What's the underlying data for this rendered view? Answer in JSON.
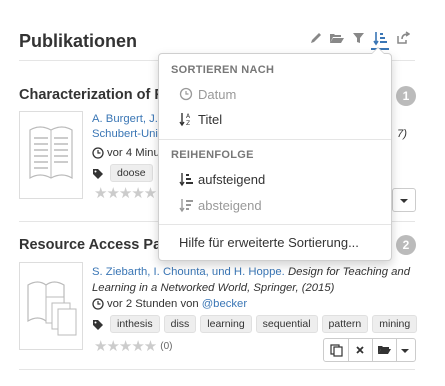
{
  "header": {
    "title": "Publikationen"
  },
  "toolbar": {
    "icons": [
      "pencil-icon",
      "folder-open-icon",
      "filter-icon",
      "sort-icon",
      "share-icon"
    ]
  },
  "publications": [
    {
      "title_visible": "Characterization of F",
      "badge": "1",
      "authors_line1": "A. Burgert, J.",
      "authors_line2": "Schubert-Uni",
      "year_suffix": "7)",
      "time": "vor 4 Minu",
      "tags": [
        "doose"
      ]
    },
    {
      "title_visible": "Resource Access Pa",
      "badge": "2",
      "authors": "S. Ziebarth, I. Chounta, und H. Hoppe.",
      "venue": "Design for Teaching and Learning in a Networked World, Springer, (2015)",
      "time_prefix": "vor 2 Stunden von",
      "user": "@becker",
      "tags": [
        "inthesis",
        "diss",
        "learning",
        "sequential",
        "pattern",
        "mining"
      ],
      "rating_count": "(0)"
    }
  ],
  "sort_menu": {
    "section_sort": "SORTIEREN NACH",
    "items_sort": [
      {
        "label": "Datum",
        "icon": "clock-icon",
        "active": false
      },
      {
        "label": "Titel",
        "icon": "sort-alpha-icon",
        "active": true
      }
    ],
    "section_order": "REIHENFOLGE",
    "items_order": [
      {
        "label": "aufsteigend",
        "icon": "sort-ascending-icon",
        "active": true
      },
      {
        "label": "absteigend",
        "icon": "sort-descending-icon",
        "active": false
      }
    ],
    "help": "Hilfe für erweiterte Sortierung..."
  },
  "colors": {
    "link": "#3a76b5",
    "badge": "#bbbbbb",
    "text": "#333333"
  }
}
